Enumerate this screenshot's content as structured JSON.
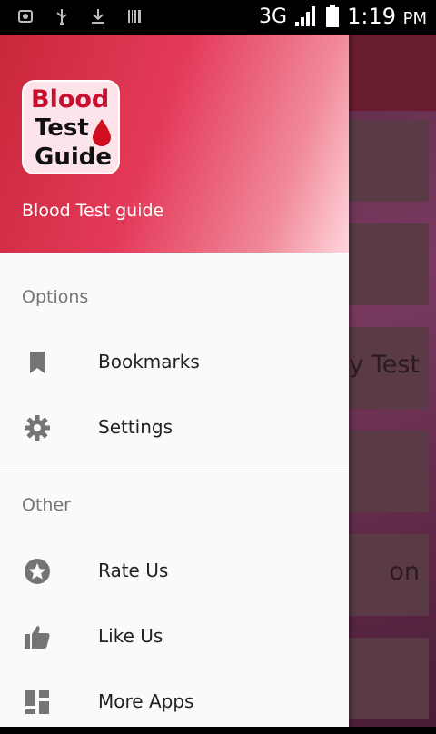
{
  "status_bar": {
    "network": "3G",
    "time": "1:19",
    "ampm": "PM",
    "left_icons": [
      "notification-icon",
      "usb-icon",
      "download-icon",
      "barcode-icon"
    ],
    "right_icons": [
      "signal-icon",
      "battery-icon"
    ]
  },
  "background_app": {
    "card_texts": [
      "y Test",
      "on"
    ]
  },
  "drawer": {
    "header": {
      "logo_line1": "Blood",
      "logo_line2": "Test",
      "logo_line3": "Guide",
      "title": "Blood Test guide",
      "gradient_colors": [
        "#c8273a",
        "#e43a5a",
        "#f08a9a",
        "#ffd6dc"
      ]
    },
    "sections": [
      {
        "label": "Options",
        "items": [
          {
            "label": "Bookmarks",
            "icon": "bookmark-icon"
          },
          {
            "label": "Settings",
            "icon": "gear-icon"
          }
        ]
      },
      {
        "label": "Other",
        "items": [
          {
            "label": "Rate Us",
            "icon": "star-icon"
          },
          {
            "label": "Like Us",
            "icon": "thumbs-up-icon"
          },
          {
            "label": "More Apps",
            "icon": "apps-icon"
          }
        ]
      }
    ]
  }
}
